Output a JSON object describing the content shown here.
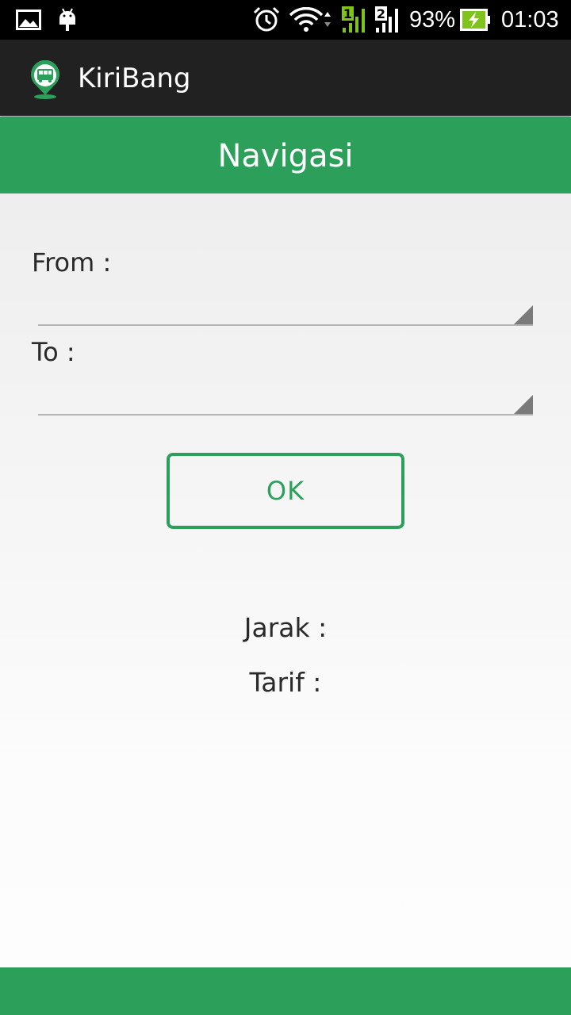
{
  "status_bar": {
    "icons": [
      "gallery-icon",
      "android-debug-icon",
      "alarm-icon",
      "wifi-icon",
      "sim1-signal-icon",
      "sim2-signal-icon",
      "battery-charging-icon"
    ],
    "sim1_label": "1",
    "sim2_label": "2",
    "battery_percent": "93%",
    "time": "01:03"
  },
  "app_bar": {
    "logo_icon": "bus-pin-icon",
    "title": "KiriBang"
  },
  "header": {
    "title": "Navigasi"
  },
  "form": {
    "from_label": "From :",
    "from_value": "",
    "to_label": "To :",
    "to_value": "",
    "ok_label": "OK"
  },
  "results": {
    "distance_label": "Jarak :",
    "fare_label": "Tarif :"
  },
  "colors": {
    "accent": "#2ca05a",
    "app_bar": "#212121",
    "status_bar": "#000000"
  }
}
